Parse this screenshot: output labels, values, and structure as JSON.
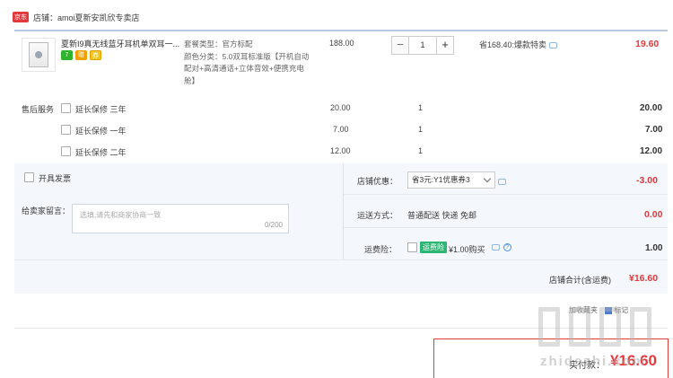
{
  "shop": {
    "badge": "京东",
    "label": "店铺：",
    "name": "amoi夏新安凯欣专卖店"
  },
  "product": {
    "name": "夏新I9真无线蓝牙耳机单双耳一...",
    "tags": [
      "7",
      "赠",
      "券"
    ],
    "spec_lines": [
      "套餐类型：官方标配",
      "颜色分类：5.0双耳标准版【开机自动配对+高清通话+立体音效+便携充电舱】"
    ],
    "unit_price": "188.00",
    "quantity": "1",
    "qty_minus": "−",
    "qty_plus": "+",
    "promo": "省168.40:爆款特卖",
    "subtotal": "19.60"
  },
  "after_sales": {
    "label": "售后服务",
    "items": [
      {
        "name": "延长保修 三年",
        "price": "20.00",
        "qty": "1",
        "subtotal": "20.00"
      },
      {
        "name": "延长保修 一年",
        "price": "7.00",
        "qty": "1",
        "subtotal": "7.00"
      },
      {
        "name": "延长保修 二年",
        "price": "12.00",
        "qty": "1",
        "subtotal": "12.00"
      }
    ]
  },
  "invoice": {
    "label": "开具发票"
  },
  "memo": {
    "label": "给卖家留言：",
    "placeholder": "选填,请先和商家协商一致",
    "count": "0/200"
  },
  "shop_coupon": {
    "label": "店铺优惠：",
    "selected": "省3元:Y1优惠券3",
    "amount": "-3.00"
  },
  "shipping": {
    "label": "运送方式：",
    "value": "普通配送 快递 免邮",
    "amount": "0.00"
  },
  "insurance": {
    "label": "运费险：",
    "badge": "运费险",
    "text": "¥1.00购买",
    "help": "?",
    "amount": "1.00"
  },
  "shop_total": {
    "label": "店铺合计(含运费)",
    "amount": "¥16.60"
  },
  "footer": {
    "fav_text": "加收藏夹",
    "tag_text": "标记",
    "total_label": "实付款：",
    "total_amount": "¥16.60",
    "watermark": "zhidezhi.com"
  }
}
